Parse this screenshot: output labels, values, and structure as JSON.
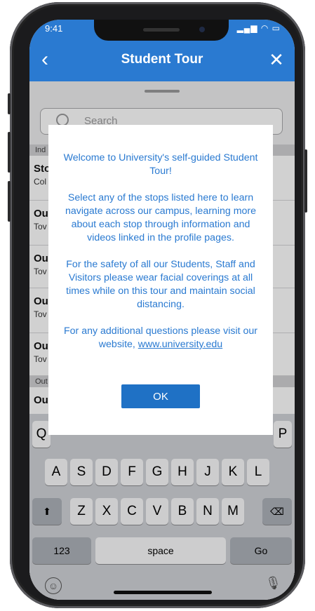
{
  "status": {
    "time": "9:41",
    "signal_icon": "signal-wifi-battery-icons"
  },
  "nav": {
    "title": "Student Tour",
    "back_icon": "chevron-left-icon",
    "close_icon": "close-icon"
  },
  "search": {
    "placeholder": "Search",
    "icon": "search-icon"
  },
  "list": {
    "sections": [
      "Ind",
      "Out"
    ],
    "rows": [
      {
        "title": "Sto",
        "subtitle": "Col"
      },
      {
        "title": "Ou",
        "subtitle": "Tov"
      },
      {
        "title": "Ou",
        "subtitle": "Tov"
      },
      {
        "title": "Ou",
        "subtitle": "Tov"
      },
      {
        "title": "Ou",
        "subtitle": "Tov"
      },
      {
        "title": "Ou",
        "subtitle": ""
      }
    ]
  },
  "modal": {
    "p1": "Welcome to University's self-guided Student Tour!",
    "p2": "Select any of the stops listed here to learn navigate across our campus, learning more about each stop through information and videos linked in the profile pages.",
    "p3": "For the safety of all our Students, Staff and Visitors please wear facial coverings at all times while on this tour and maintain social distancing.",
    "p4": "For any additional questions please visit our website,",
    "link": "www.university.edu",
    "ok_label": "OK"
  },
  "keyboard": {
    "row1_visible": [
      "Q",
      "P"
    ],
    "row2": [
      "A",
      "S",
      "D",
      "F",
      "G",
      "H",
      "J",
      "K",
      "L"
    ],
    "row3": [
      "Z",
      "X",
      "C",
      "V",
      "B",
      "N",
      "M"
    ],
    "shift_icon": "shift-icon",
    "delete_icon": "backspace-icon",
    "numbers_label": "123",
    "space_label": "space",
    "go_label": "Go",
    "emoji_icon": "emoji-icon",
    "mic_icon": "microphone-icon"
  }
}
